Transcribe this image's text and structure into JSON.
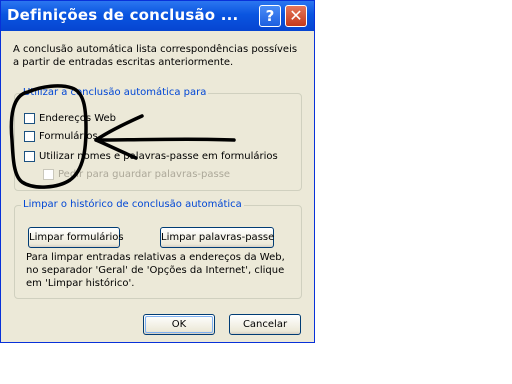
{
  "window": {
    "title": "Definições de conclusão ...",
    "help_glyph": "?",
    "close_glyph": "✕"
  },
  "description": "A conclusão automática lista correspondências possíveis a partir de entradas escritas anteriormente.",
  "autocomplete_group": {
    "legend": "Utilizar a conclusão automática para",
    "options": [
      {
        "label": "Endereços Web",
        "checked": false,
        "enabled": true
      },
      {
        "label": "Formulários",
        "checked": false,
        "enabled": true
      },
      {
        "label": "Utilizar nomes e palavras-passe em formulários",
        "checked": false,
        "enabled": true
      },
      {
        "label": "Pedir para guardar palavras-passe",
        "checked": false,
        "enabled": false
      }
    ]
  },
  "history_group": {
    "legend": "Limpar o histórico de conclusão automática",
    "clear_forms_label": "Limpar formulários",
    "clear_passwords_label": "Limpar palavras-passe",
    "info_text": "Para limpar entradas relativas a endereços da Web, no separador 'Geral' de 'Opções da Internet', clique em 'Limpar histórico'."
  },
  "footer": {
    "ok_label": "OK",
    "cancel_label": "Cancelar"
  },
  "colors": {
    "titlebar": "#0a55e0",
    "dialog_bg": "#ece9d8",
    "legend_text": "#0046d5",
    "annotation": "#000000"
  }
}
